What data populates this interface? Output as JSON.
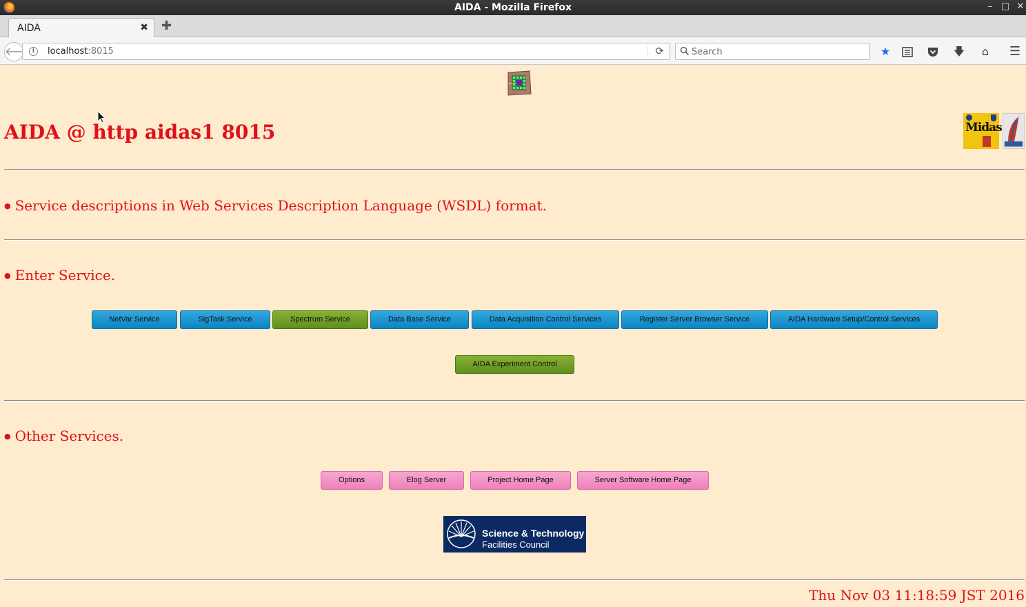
{
  "browser": {
    "window_title": "AIDA - Mozilla Firefox",
    "tab_title": "AIDA",
    "url_host": "localhost",
    "url_port": ":8015",
    "search_placeholder": "Search"
  },
  "page": {
    "title": "AIDA @ http aidas1 8015",
    "sections": {
      "wsdl": "Service descriptions in Web Services Description Language (WSDL) format.",
      "enter": "Enter Service.",
      "other": "Other Services."
    },
    "service_buttons": {
      "netvar": "NetVar Service",
      "sigtask": "SigTask Service",
      "spectrum": "Spectrum Service",
      "database": "Data Base Service",
      "daq": "Data Acquisition Control Services",
      "register": "Register Server Browser Service",
      "hardware": "AIDA Hardware Setup/Control Services",
      "experiment": "AIDA Experiment Control"
    },
    "other_buttons": {
      "options": "Options",
      "elog": "Elog Server",
      "project": "Project Home Page",
      "software": "Server Software Home Page"
    },
    "logos": {
      "midas": "Midas",
      "stfc_line1": "Science & Technology",
      "stfc_line2": "Facilities Council"
    },
    "timestamp": "Thu Nov 03 11:18:59 JST 2016"
  },
  "colors": {
    "page_background": "#ffebcd",
    "heading_red": "#e0101a",
    "button_blue": "#0a86c4",
    "button_green": "#5f8f1e",
    "button_pink": "#ee82bb"
  }
}
